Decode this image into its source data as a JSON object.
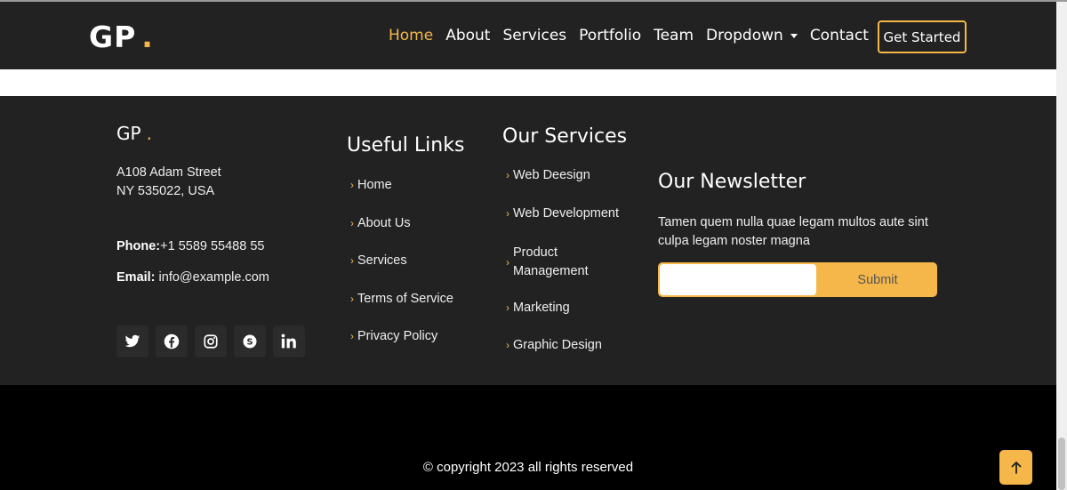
{
  "header": {
    "logo_text": "GP",
    "logo_dot": ".",
    "nav": [
      "Home",
      "About",
      "Services",
      "Portfolio",
      "Team",
      "Dropdown",
      "Contact"
    ],
    "active_nav": "Home",
    "cta_label": "Get Started"
  },
  "footer": {
    "logo_text": "GP",
    "logo_dot": ".",
    "address_line1": "A108 Adam Street",
    "address_line2": "NY 535022, USA",
    "phone_label": "Phone:",
    "phone_value": "+1 5589 55488 55",
    "email_label": "Email:",
    "email_value": "info@example.com",
    "social_icons": [
      "twitter-icon",
      "facebook-icon",
      "instagram-icon",
      "skype-icon",
      "linkedin-icon"
    ],
    "useful_links": {
      "title": "Useful Links",
      "items": [
        "Home",
        "About Us",
        "Services",
        "Terms of Service",
        "Privacy Policy"
      ]
    },
    "services": {
      "title": "Our Services",
      "items": [
        "Web Deesign",
        "Web Development",
        "Product Management",
        "Marketing",
        "Graphic Design"
      ]
    },
    "newsletter": {
      "title": "Our Newsletter",
      "description": "Tamen quem nulla quae legam multos aute sint culpa legam noster magna",
      "input_value": "",
      "submit_label": "Submit"
    },
    "copyright": "© copyright 2023 all rights reserved"
  },
  "colors": {
    "accent": "#f5b74a",
    "dark": "#222222",
    "black": "#000000"
  }
}
